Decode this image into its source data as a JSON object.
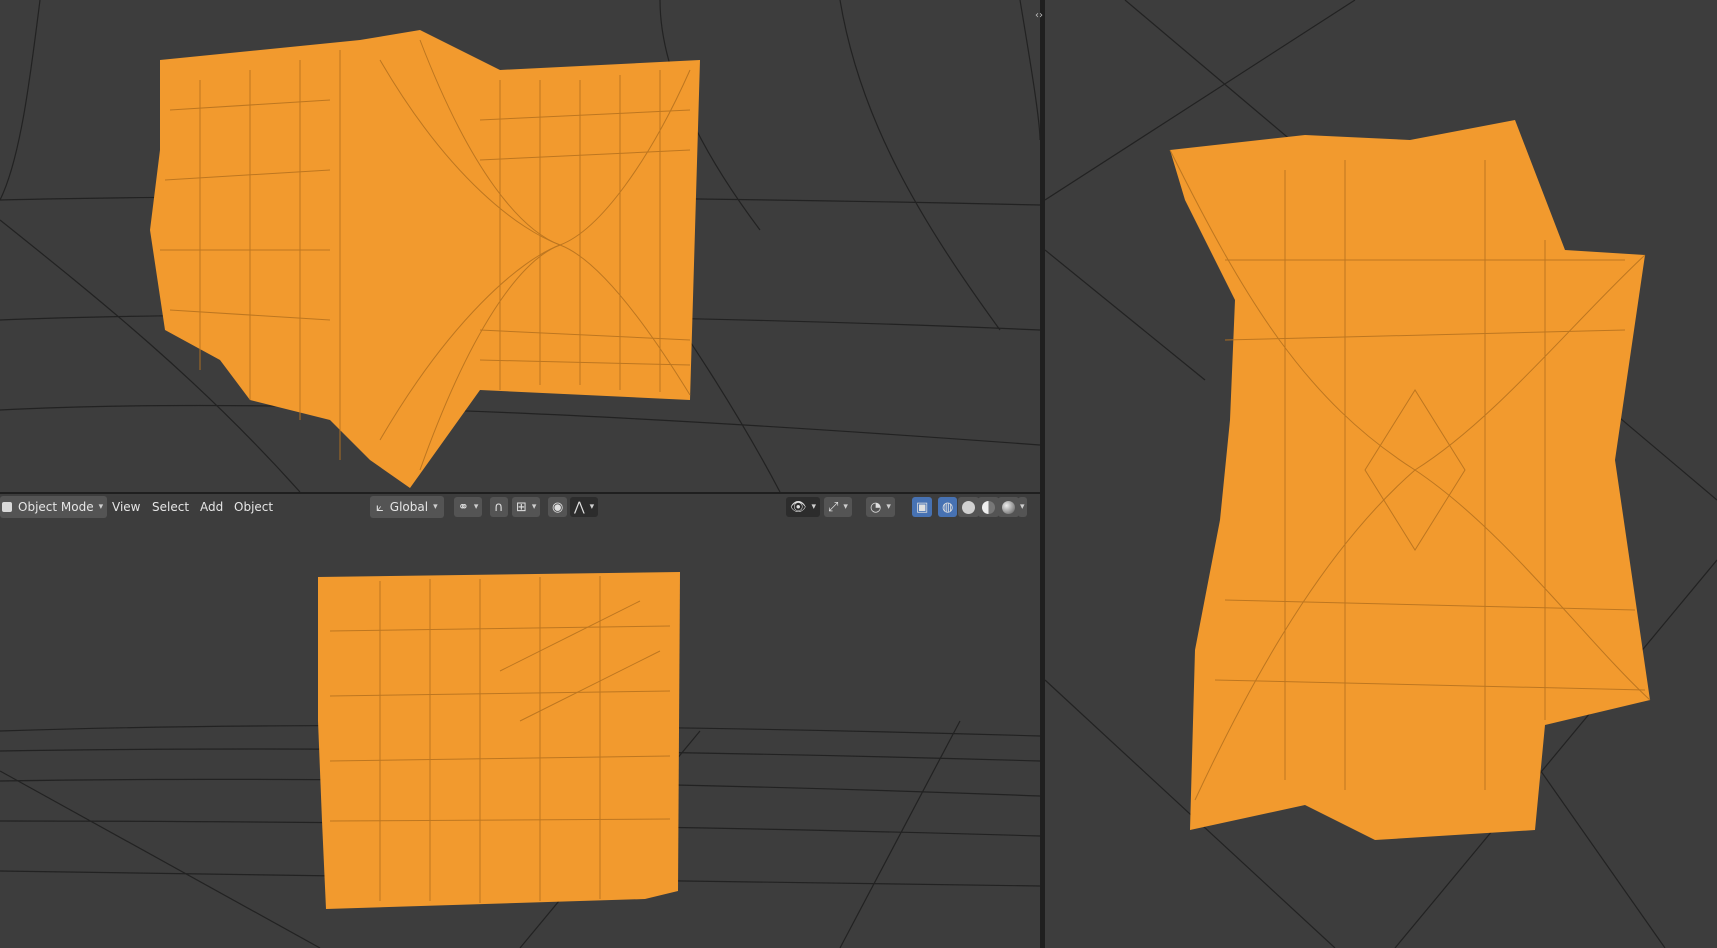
{
  "header": {
    "mode_label": "Object Mode",
    "menus": [
      "View",
      "Select",
      "Add",
      "Object"
    ],
    "orientation_label": "Global"
  },
  "icons": {
    "mode": "object-mode-icon",
    "orientation": "transform-orientation-icon",
    "pivot": "pivot-point-icon",
    "snap": "snap-icon",
    "snap_target": "snap-increment-icon",
    "proportional": "proportional-editing-icon",
    "falloff": "falloff-curve-icon",
    "visibility": "eye-icon",
    "gizmo": "gizmo-icon",
    "overlay": "overlay-icon",
    "xray": "xray-icon",
    "shading_wire": "wireframe-shading-icon",
    "shading_solid": "solid-shading-icon",
    "shading_material": "material-shading-icon",
    "shading_rendered": "rendered-shading-icon"
  },
  "colors": {
    "background": "#3d3d3d",
    "mesh": "#f29a2e",
    "wire": "#c67f26",
    "grid": "#1f1f1f",
    "active": "#4772b3"
  }
}
